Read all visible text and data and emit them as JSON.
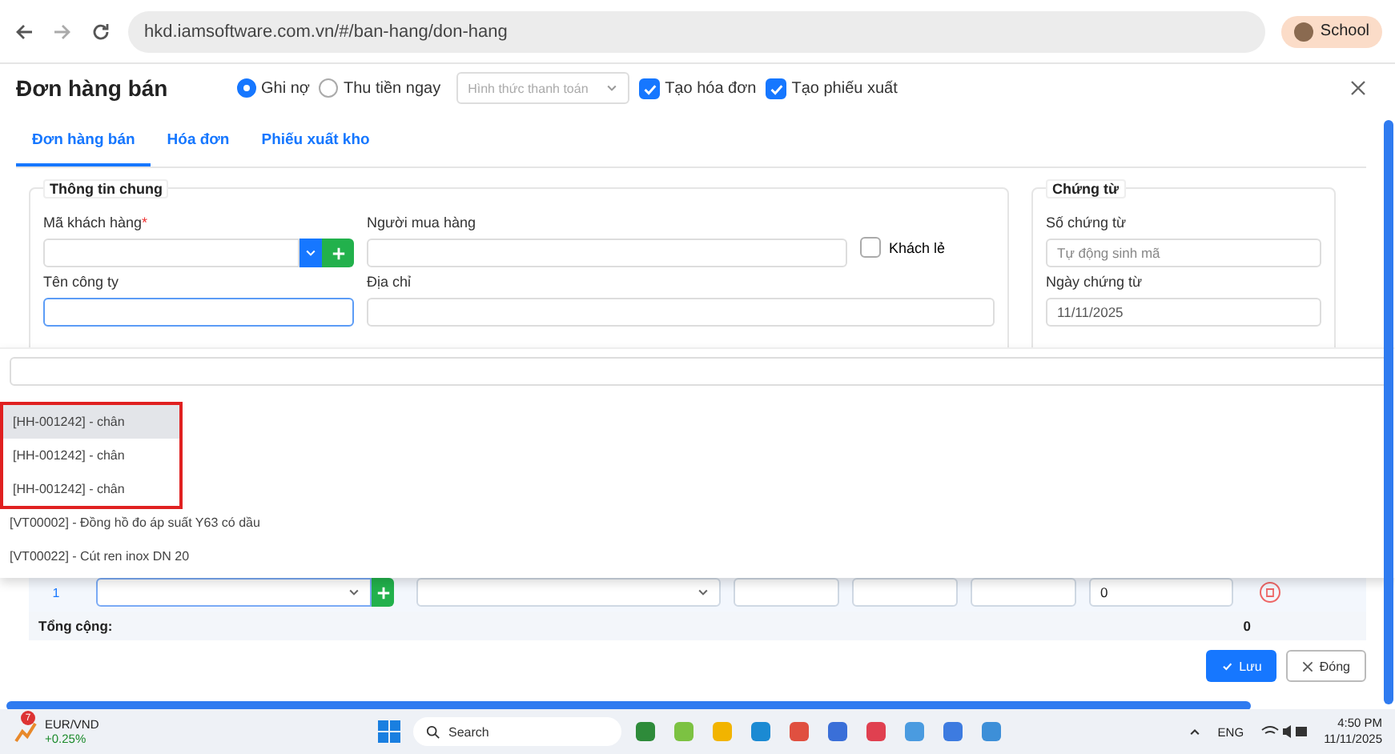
{
  "browser": {
    "url": "hkd.iamsoftware.com.vn/#/ban-hang/don-hang",
    "profile": "School"
  },
  "modal": {
    "title": "Đơn hàng bán",
    "payment_options": [
      {
        "label": "Ghi nợ",
        "selected": true
      },
      {
        "label": "Thu tiền ngay",
        "selected": false
      }
    ],
    "payment_method": {
      "placeholder": "Hình thức thanh toán"
    },
    "options": [
      {
        "label": "Tạo hóa đơn",
        "checked": true
      },
      {
        "label": "Tạo phiếu xuất",
        "checked": true
      }
    ]
  },
  "tabs": [
    {
      "label": "Đơn hàng bán",
      "selected": true
    },
    {
      "label": "Hóa đơn",
      "selected": false
    },
    {
      "label": "Phiếu xuất kho",
      "selected": false
    }
  ],
  "general": {
    "title": "Thông tin chung",
    "customer_code": {
      "label": "Mã khách hàng",
      "required_mark": "*"
    },
    "buyer": {
      "label": "Người mua hàng"
    },
    "walk_in": {
      "label": "Khách lẻ",
      "checked": false
    },
    "company": {
      "label": "Tên công ty",
      "focused": true
    },
    "address": {
      "label": "Địa chỉ"
    }
  },
  "voucher": {
    "title": "Chứng từ",
    "number": {
      "label": "Số chứng từ",
      "placeholder": "Tự động sinh mã"
    },
    "date": {
      "label": "Ngày chứng từ",
      "value": "11/11/2025"
    }
  },
  "dropdown": {
    "items": [
      {
        "label": "[HH-001242] - chân",
        "selected": true,
        "marked": true
      },
      {
        "label": "[HH-001242] - chân",
        "selected": false,
        "marked": true
      },
      {
        "label": "[HH-001242] - chân",
        "selected": false,
        "marked": true
      },
      {
        "label": "[VT00002] - Đồng hồ đo áp suất Y63 có dầu",
        "selected": false,
        "marked": false
      },
      {
        "label": "[VT00022] - Cút ren inox DN 20",
        "selected": false,
        "marked": false
      }
    ]
  },
  "table": {
    "row": {
      "index": "1",
      "amount": "0"
    },
    "total": {
      "label": "Tổng cộng:",
      "value": "0"
    }
  },
  "buttons": {
    "save": "Lưu",
    "close": "Đóng"
  },
  "taskbar": {
    "widget": {
      "badge": "7",
      "title": "EUR/VND",
      "change": "+0.25%"
    },
    "search": {
      "placeholder": "Search"
    },
    "language": "ENG",
    "time": "4:50 PM",
    "date": "11/11/2025"
  }
}
